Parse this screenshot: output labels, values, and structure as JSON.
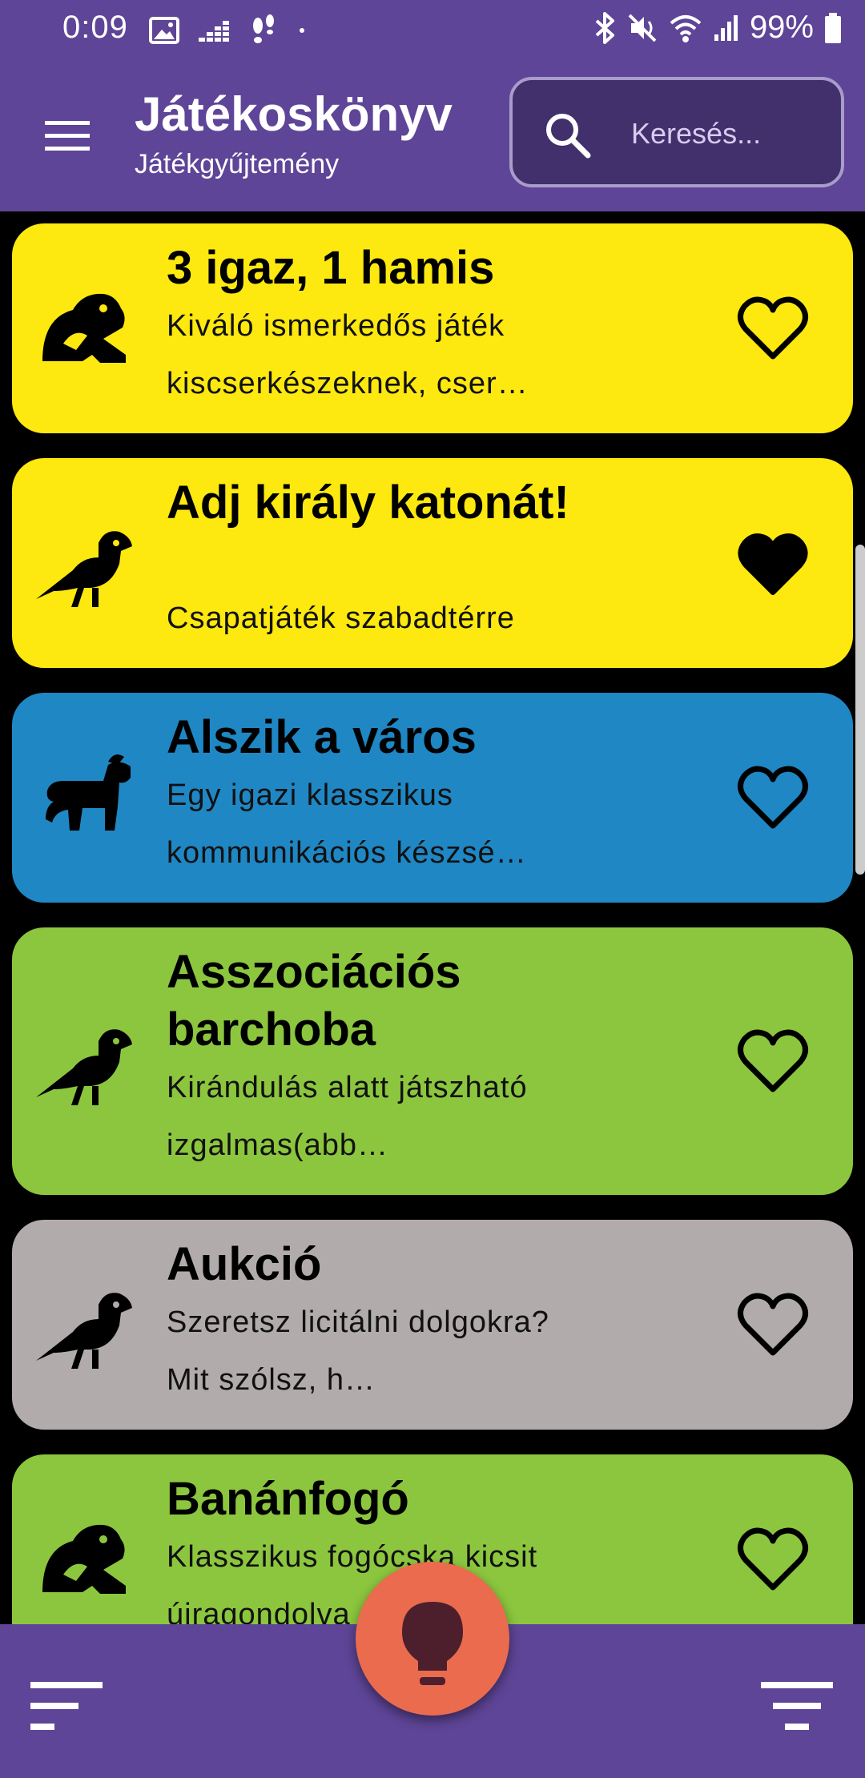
{
  "status_bar": {
    "time": "0:09",
    "battery_percent": "99%",
    "icons": [
      "image-icon",
      "deezer-icon",
      "footsteps-icon",
      "dot-icon",
      "bluetooth-icon",
      "mute-icon",
      "wifi-icon",
      "signal-icon",
      "battery-icon"
    ]
  },
  "app_bar": {
    "title": "Játékoskönyv",
    "subtitle": "Játékgyűjtemény",
    "menu_icon": "hamburger-menu-icon",
    "search": {
      "placeholder": "Keresés...",
      "value": "",
      "icon": "search-icon"
    }
  },
  "colors": {
    "primary": "#5e4597",
    "search_bg": "#42306d",
    "yellow": "#fde80f",
    "blue": "#1f87c4",
    "green": "#8cc63e",
    "gray": "#b1abab",
    "fab": "#ea6b4e",
    "fab_icon": "#4d1f2c"
  },
  "games": [
    {
      "title": "3 igaz, 1 hamis",
      "description": "Kiváló ismerkedős játék kiscserkészeknek, cser…",
      "icon": "frog-icon",
      "color": "yellow",
      "favorite": false
    },
    {
      "title": "Adj király katonát!",
      "description": "Csapatjáték szabadtérre",
      "icon": "crow-icon",
      "color": "yellow",
      "favorite": true
    },
    {
      "title": "Alszik a város",
      "description": "Egy igazi klasszikus kommunikációs készsé…",
      "icon": "horse-icon",
      "color": "blue",
      "favorite": false
    },
    {
      "title": "Asszociációs barchoba",
      "description": "Kirándulás alatt játszható izgalmas(abb…",
      "icon": "crow-icon",
      "color": "green",
      "favorite": false
    },
    {
      "title": "Aukció",
      "description": "Szeretsz licitálni dolgokra? Mit szólsz, h…",
      "icon": "crow-icon",
      "color": "gray",
      "favorite": false
    },
    {
      "title": "Banánfogó",
      "description": "Klasszikus fogócska kicsit újragondolva",
      "icon": "frog-icon",
      "color": "green",
      "favorite": false
    }
  ],
  "bottom_bar": {
    "sort_icon": "sort-icon",
    "fab_icon": "lightbulb-icon",
    "filter_icon": "filter-icon"
  }
}
